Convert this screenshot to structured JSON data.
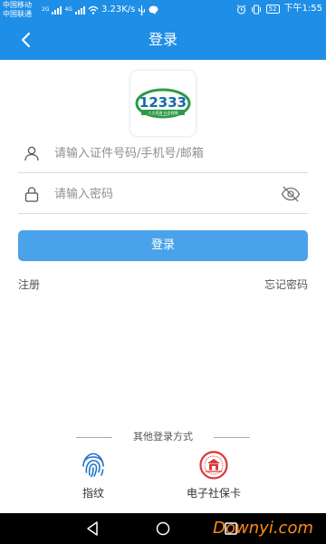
{
  "status_bar": {
    "carrier1": "中国移动",
    "carrier2": "中国联通",
    "net1": "2G",
    "net2": "4G",
    "speed": "3.23K/s",
    "battery": "52",
    "time": "下午1:55"
  },
  "header": {
    "title": "登录"
  },
  "logo": {
    "text": "12333",
    "subtitle": "人力资源 社会保障"
  },
  "form": {
    "username_placeholder": "请输入证件号码/手机号/邮箱",
    "username_value": "",
    "password_placeholder": "请输入密码",
    "password_value": "",
    "login_label": "登录",
    "register_label": "注册",
    "forgot_label": "忘记密码"
  },
  "other_login": {
    "title": "其他登录方式",
    "options": [
      {
        "label": "指纹",
        "icon": "fingerprint-icon"
      },
      {
        "label": "电子社保卡",
        "icon": "social-security-card-icon"
      }
    ]
  },
  "watermark": "Downyi.com",
  "colors": {
    "primary": "#1e8ee6",
    "button": "#4aa3ea",
    "fingerprint": "#1f73c9",
    "card_red": "#d8393a"
  }
}
